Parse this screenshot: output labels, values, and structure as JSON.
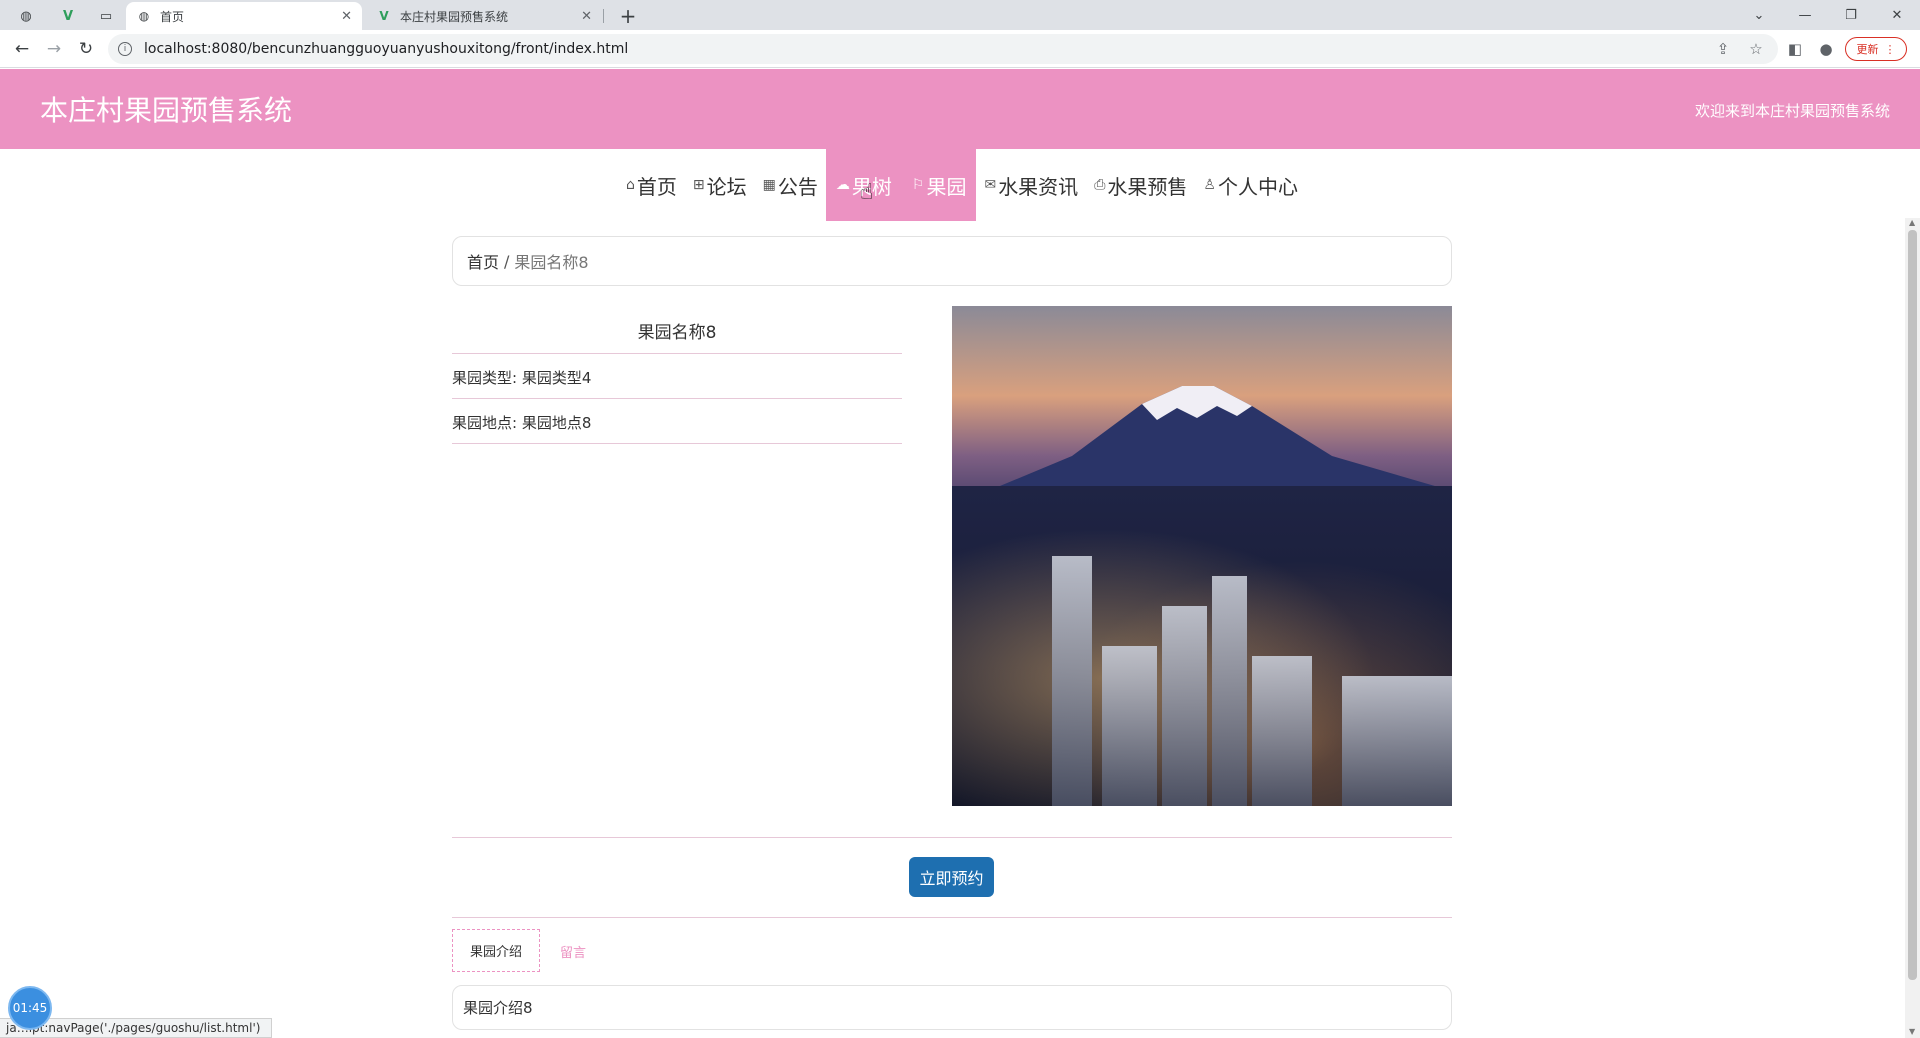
{
  "browser": {
    "tabs": [
      {
        "title": "首页",
        "active": true
      },
      {
        "title": "本庄村果园预售系统",
        "active": false
      }
    ],
    "url": "localhost:8080/bencunzhuangguoyuanyushouxitong/front/index.html",
    "update_label": "更新",
    "status_text": "ja…ipt:navPage('./pages/guoshu/list.html')",
    "timer": "01:45"
  },
  "header": {
    "site_title": "本庄村果园预售系统",
    "welcome": "欢迎来到本庄村果园预售系统"
  },
  "nav": [
    {
      "label": "首页",
      "icon": "home-icon",
      "glyph": "⌂",
      "highlighted": false
    },
    {
      "label": "论坛",
      "icon": "forum-icon",
      "glyph": "⊞",
      "highlighted": false
    },
    {
      "label": "公告",
      "icon": "notice-icon",
      "glyph": "▦",
      "highlighted": false
    },
    {
      "label": "果树",
      "icon": "tree-icon",
      "glyph": "☁",
      "highlighted": true
    },
    {
      "label": "果园",
      "icon": "flag-icon",
      "glyph": "⚐",
      "highlighted": true
    },
    {
      "label": "水果资讯",
      "icon": "mail-icon",
      "glyph": "✉",
      "highlighted": false
    },
    {
      "label": "水果预售",
      "icon": "printer-icon",
      "glyph": "⎙",
      "highlighted": false
    },
    {
      "label": "个人中心",
      "icon": "user-icon",
      "glyph": "♙",
      "highlighted": false
    }
  ],
  "breadcrumb": {
    "home": "首页",
    "separator": "/",
    "current": "果园名称8"
  },
  "detail": {
    "title": "果园名称8",
    "type_label": "果园类型: 果园类型4",
    "location_label": "果园地点: 果园地点8",
    "photo_caption": "Mount Fuji and city skyline at dusk"
  },
  "actions": {
    "reserve": "立即预约"
  },
  "tabs": {
    "intro": "果园介绍",
    "message": "留言"
  },
  "intro_text": "果园介绍8",
  "colors": {
    "accent_pink": "#ec92c2",
    "button_blue": "#1e6fb0"
  }
}
